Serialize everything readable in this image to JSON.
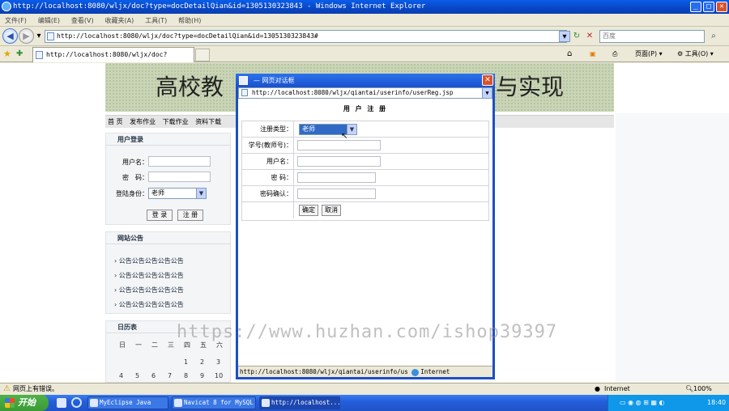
{
  "window": {
    "title": "http://localhost:8080/wljx/doc?type=docDetailQian&id=1305130323843 - Windows Internet Explorer"
  },
  "menu": [
    "文件(F)",
    "编辑(E)",
    "查看(V)",
    "收藏夹(A)",
    "工具(T)",
    "帮助(H)"
  ],
  "address": {
    "url": "http://localhost:8080/wljx/doc?type=docDetailQian&id=1305130323843#",
    "search_placeholder": "百度"
  },
  "tab": {
    "label": "http://localhost:8080/wljx/doc?type=docDe..."
  },
  "toolbar": {
    "page": "页面(P)",
    "tools": "工具(O)"
  },
  "site": {
    "banner_left": "高校教",
    "banner_right": "与实现",
    "nav": [
      "首 页",
      "发布作业",
      "下载作业",
      "资料下载"
    ],
    "login": {
      "header": "用户登录",
      "username_label": "用户名：",
      "password_label": "密　码：",
      "role_label": "登陆身份：",
      "role_value": "老师",
      "login_btn": "登 录",
      "register_btn": "注 册"
    },
    "announce": {
      "header": "网站公告",
      "items": [
        "公告公告公告公告公告",
        "公告公告公告公告公告",
        "公告公告公告公告公告",
        "公告公告公告公告公告"
      ]
    },
    "calendar": {
      "header": "日历表",
      "days": [
        "日",
        "一",
        "二",
        "三",
        "四",
        "五",
        "六"
      ],
      "row1": [
        "1",
        "2",
        "3"
      ],
      "row2": [
        "4",
        "5",
        "6",
        "7",
        "8",
        "9",
        "10"
      ]
    }
  },
  "dialog": {
    "title": "网页对话框",
    "url": "http://localhost:8080/wljx/qiantai/userinfo/userReg.jsp",
    "heading": "用 户 注 册",
    "fields": {
      "type_label": "注册类型：",
      "type_value": "老师",
      "id_label": "学号(教师号)：",
      "username_label": "用户名：",
      "password_label": "密 码：",
      "confirm_label": "密码确认："
    },
    "ok": "确定",
    "cancel": "取消",
    "status_url": "http://localhost:8080/wljx/qiantai/userinfo/us",
    "status_zone": "Internet"
  },
  "watermark": "https://www.huzhan.com/ishop39397",
  "statusbar": {
    "left": "网页上有错误。",
    "zone": "Internet",
    "zoom": "100%"
  },
  "taskbar": {
    "start": "开始",
    "tasks": [
      "MyEclipse Java E...",
      "Navicat 8 for MySQL",
      "http://localhost..."
    ],
    "clock": "18:40"
  }
}
